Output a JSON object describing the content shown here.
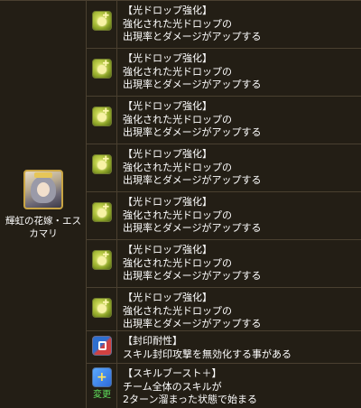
{
  "character": {
    "name": "輝虹の花嫁・エスカマリ",
    "portrait": "character-portrait"
  },
  "awakenings": [
    {
      "icon": "light-drop-enhance-icon",
      "title": "【光ドロップ強化】",
      "line1": "強化された光ドロップの",
      "line2": "出現率とダメージがアップする"
    },
    {
      "icon": "light-drop-enhance-icon",
      "title": "【光ドロップ強化】",
      "line1": "強化された光ドロップの",
      "line2": "出現率とダメージがアップする"
    },
    {
      "icon": "light-drop-enhance-icon",
      "title": "【光ドロップ強化】",
      "line1": "強化された光ドロップの",
      "line2": "出現率とダメージがアップする"
    },
    {
      "icon": "light-drop-enhance-icon",
      "title": "【光ドロップ強化】",
      "line1": "強化された光ドロップの",
      "line2": "出現率とダメージがアップする"
    },
    {
      "icon": "light-drop-enhance-icon",
      "title": "【光ドロップ強化】",
      "line1": "強化された光ドロップの",
      "line2": "出現率とダメージがアップする"
    },
    {
      "icon": "light-drop-enhance-icon",
      "title": "【光ドロップ強化】",
      "line1": "強化された光ドロップの",
      "line2": "出現率とダメージがアップする"
    },
    {
      "icon": "light-drop-enhance-icon",
      "title": "【光ドロップ強化】",
      "line1": "強化された光ドロップの",
      "line2": "出現率とダメージがアップする"
    },
    {
      "icon": "skill-bind-resist-icon",
      "title": "【封印耐性】",
      "line1": "スキル封印攻撃を無効化する事がある"
    },
    {
      "icon": "skill-boost-plus-icon",
      "change_label": "変更",
      "title": "【スキルブースト＋】",
      "line1": "チーム全体のスキルが",
      "line2": "2ターン溜まった状態で始まる"
    }
  ]
}
